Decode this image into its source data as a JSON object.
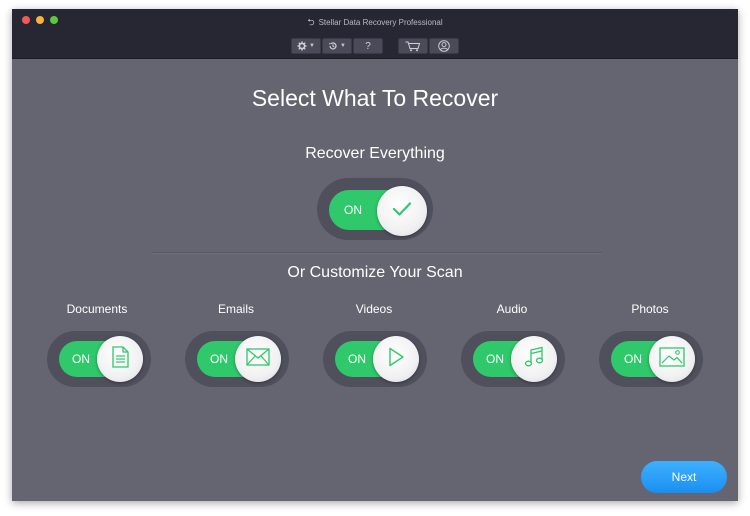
{
  "window": {
    "title": "Stellar Data Recovery Professional"
  },
  "toolbar": {
    "help_label": "?",
    "settings_icon": "gear-icon",
    "history_icon": "history-icon",
    "cart_icon": "cart-icon",
    "account_icon": "account-icon"
  },
  "main": {
    "heading": "Select What To Recover",
    "recover_everything": {
      "label": "Recover Everything",
      "toggle_text": "ON",
      "state": "on",
      "icon": "checkmark-icon"
    },
    "customize_heading": "Or Customize Your Scan",
    "categories": [
      {
        "label": "Documents",
        "toggle_text": "ON",
        "state": "on",
        "icon": "document-icon"
      },
      {
        "label": "Emails",
        "toggle_text": "ON",
        "state": "on",
        "icon": "envelope-icon"
      },
      {
        "label": "Videos",
        "toggle_text": "ON",
        "state": "on",
        "icon": "play-icon"
      },
      {
        "label": "Audio",
        "toggle_text": "ON",
        "state": "on",
        "icon": "music-note-icon"
      },
      {
        "label": "Photos",
        "toggle_text": "ON",
        "state": "on",
        "icon": "image-icon"
      }
    ]
  },
  "footer": {
    "next_label": "Next"
  },
  "colors": {
    "background": "#646570",
    "titlebar": "#262732",
    "toggle_on": "#2fc86a",
    "next_button": "#1a8ff0",
    "icon_stroke": "#2fc86a"
  }
}
